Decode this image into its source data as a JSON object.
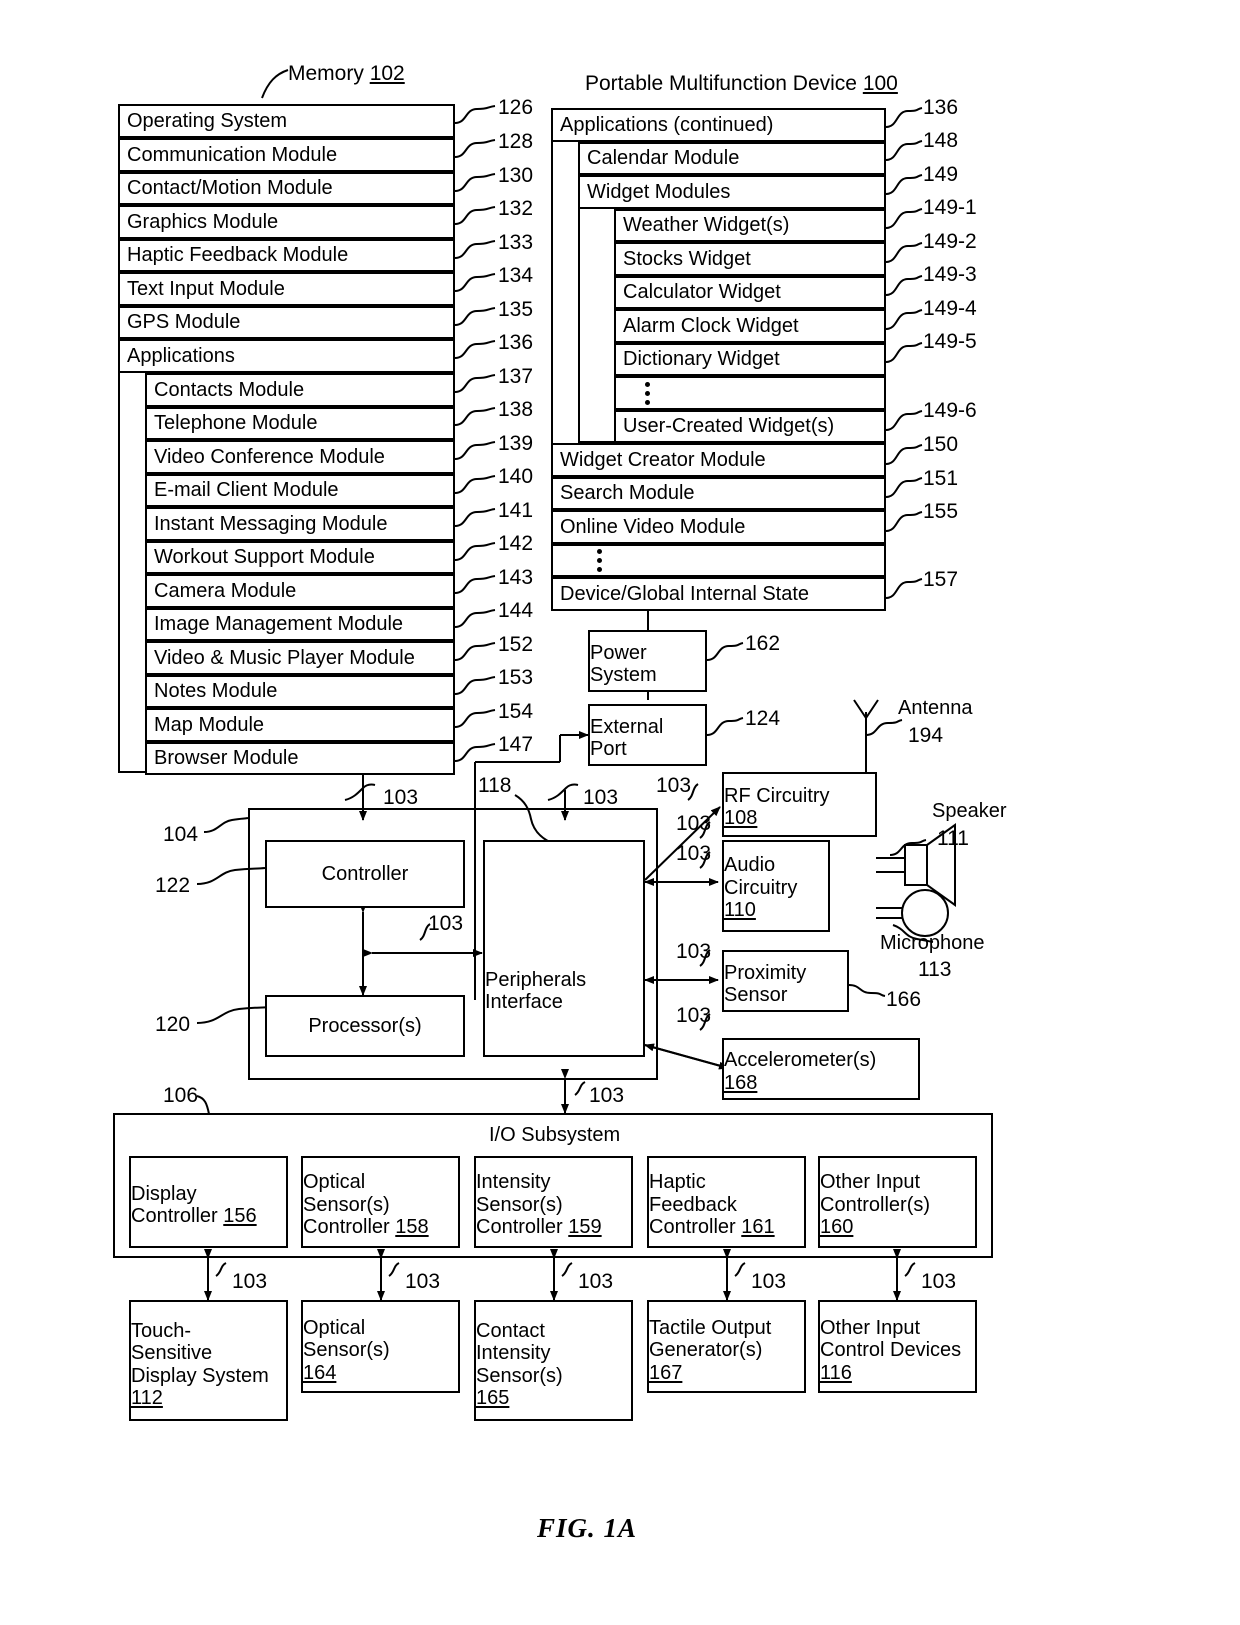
{
  "figure": {
    "caption": "FIG. 1A"
  },
  "memory": {
    "title": "Memory",
    "ref": "102",
    "rows": [
      {
        "label": "Operating System",
        "ref": "126"
      },
      {
        "label": "Communication Module",
        "ref": "128"
      },
      {
        "label": "Contact/Motion Module",
        "ref": "130"
      },
      {
        "label": "Graphics Module",
        "ref": "132"
      },
      {
        "label": "Haptic Feedback Module",
        "ref": "133"
      },
      {
        "label": "Text Input Module",
        "ref": "134"
      },
      {
        "label": "GPS Module",
        "ref": "135"
      },
      {
        "label": "Applications",
        "ref": "136"
      }
    ],
    "applications": [
      {
        "label": "Contacts Module",
        "ref": "137"
      },
      {
        "label": "Telephone Module",
        "ref": "138"
      },
      {
        "label": "Video Conference Module",
        "ref": "139"
      },
      {
        "label": "E-mail Client Module",
        "ref": "140"
      },
      {
        "label": "Instant Messaging Module",
        "ref": "141"
      },
      {
        "label": "Workout Support Module",
        "ref": "142"
      },
      {
        "label": "Camera Module",
        "ref": "143"
      },
      {
        "label": "Image Management Module",
        "ref": "144"
      },
      {
        "label": "Video & Music Player Module",
        "ref": "152"
      },
      {
        "label": "Notes Module",
        "ref": "153"
      },
      {
        "label": "Map Module",
        "ref": "154"
      },
      {
        "label": "Browser Module",
        "ref": "147"
      }
    ]
  },
  "device": {
    "title": "Portable Multifunction Device",
    "ref": "100",
    "applications_continued": {
      "label": "Applications (continued)",
      "ref": "136"
    },
    "calendar": {
      "label": "Calendar Module",
      "ref": "148"
    },
    "widget_modules": {
      "label": "Widget Modules",
      "ref": "149"
    },
    "widgets": [
      {
        "label": "Weather Widget(s)",
        "ref": "149-1"
      },
      {
        "label": "Stocks Widget",
        "ref": "149-2"
      },
      {
        "label": "Calculator Widget",
        "ref": "149-3"
      },
      {
        "label": "Alarm Clock Widget",
        "ref": "149-4"
      },
      {
        "label": "Dictionary Widget",
        "ref": "149-5"
      }
    ],
    "widget_ellipsis": "vertical-ellipsis",
    "user_created": {
      "label": "User-Created Widget(s)",
      "ref": "149-6"
    },
    "tail_modules": [
      {
        "label": "Widget Creator Module",
        "ref": "150"
      },
      {
        "label": "Search Module",
        "ref": "151"
      },
      {
        "label": "Online Video Module",
        "ref": "155"
      }
    ],
    "apps_ellipsis": "vertical-ellipsis",
    "internal_state": {
      "label": "Device/Global Internal State",
      "ref": "157"
    }
  },
  "peripherals": {
    "power_system": {
      "label": "Power\nSystem",
      "line1": "Power",
      "line2": "System",
      "ref": "162"
    },
    "external_port": {
      "label": "External\nPort",
      "line1": "External",
      "line2": "Port",
      "ref": "124"
    },
    "rf_circuitry": {
      "line1": "RF Circuitry",
      "ref": "108"
    },
    "audio_circuitry": {
      "line1": "Audio",
      "line2": "Circuitry",
      "ref": "110"
    },
    "proximity_sensor": {
      "line1": "Proximity",
      "line2": "Sensor",
      "ref": "166"
    },
    "accelerometers": {
      "line1": "Accelerometer(s)",
      "ref": "168"
    },
    "antenna": {
      "label": "Antenna",
      "ref": "194"
    },
    "speaker": {
      "label": "Speaker",
      "ref": "111"
    },
    "microphone": {
      "label": "Microphone",
      "ref": "113"
    }
  },
  "core": {
    "ref": "104",
    "controller": {
      "label": "Controller",
      "ref": "122"
    },
    "processors": {
      "label": "Processor(s)",
      "ref": "120"
    },
    "peripherals_interface": {
      "line1": "Peripherals",
      "line2": "Interface",
      "ref": "118"
    }
  },
  "io_subsystem": {
    "title": "I/O Subsystem",
    "ref": "106",
    "controllers": [
      {
        "line1": "Display",
        "line2": "Controller",
        "ref": "156"
      },
      {
        "line1": "Optical",
        "line2": "Sensor(s)",
        "line3": "Controller",
        "ref": "158"
      },
      {
        "line1": "Intensity",
        "line2": "Sensor(s)",
        "line3": "Controller",
        "ref": "159"
      },
      {
        "line1": "Haptic",
        "line2": "Feedback",
        "line3": "Controller",
        "ref": "161"
      },
      {
        "line1": "Other Input",
        "line2": "Controller(s)",
        "ref": "160"
      }
    ],
    "devices": [
      {
        "line1": "Touch-",
        "line2": "Sensitive",
        "line3": "Display System",
        "ref": "112"
      },
      {
        "line1": "Optical",
        "line2": "Sensor(s)",
        "ref": "164"
      },
      {
        "line1": "Contact",
        "line2": "Intensity",
        "line3": "Sensor(s)",
        "ref": "165"
      },
      {
        "line1": "Tactile Output",
        "line2": "Generator(s)",
        "ref": "167"
      },
      {
        "line1": "Other Input",
        "line2": "Control Devices",
        "ref": "116"
      }
    ]
  },
  "bus_labels": {
    "memory_to_core": "103",
    "port_to_core": "103",
    "core_internal": "103",
    "peri_to_rf": "103",
    "peri_to_audio": "103",
    "peri_to_prox": "103",
    "peri_to_accel": "103",
    "peri_to_io": "103",
    "io_to_devices": "103"
  }
}
